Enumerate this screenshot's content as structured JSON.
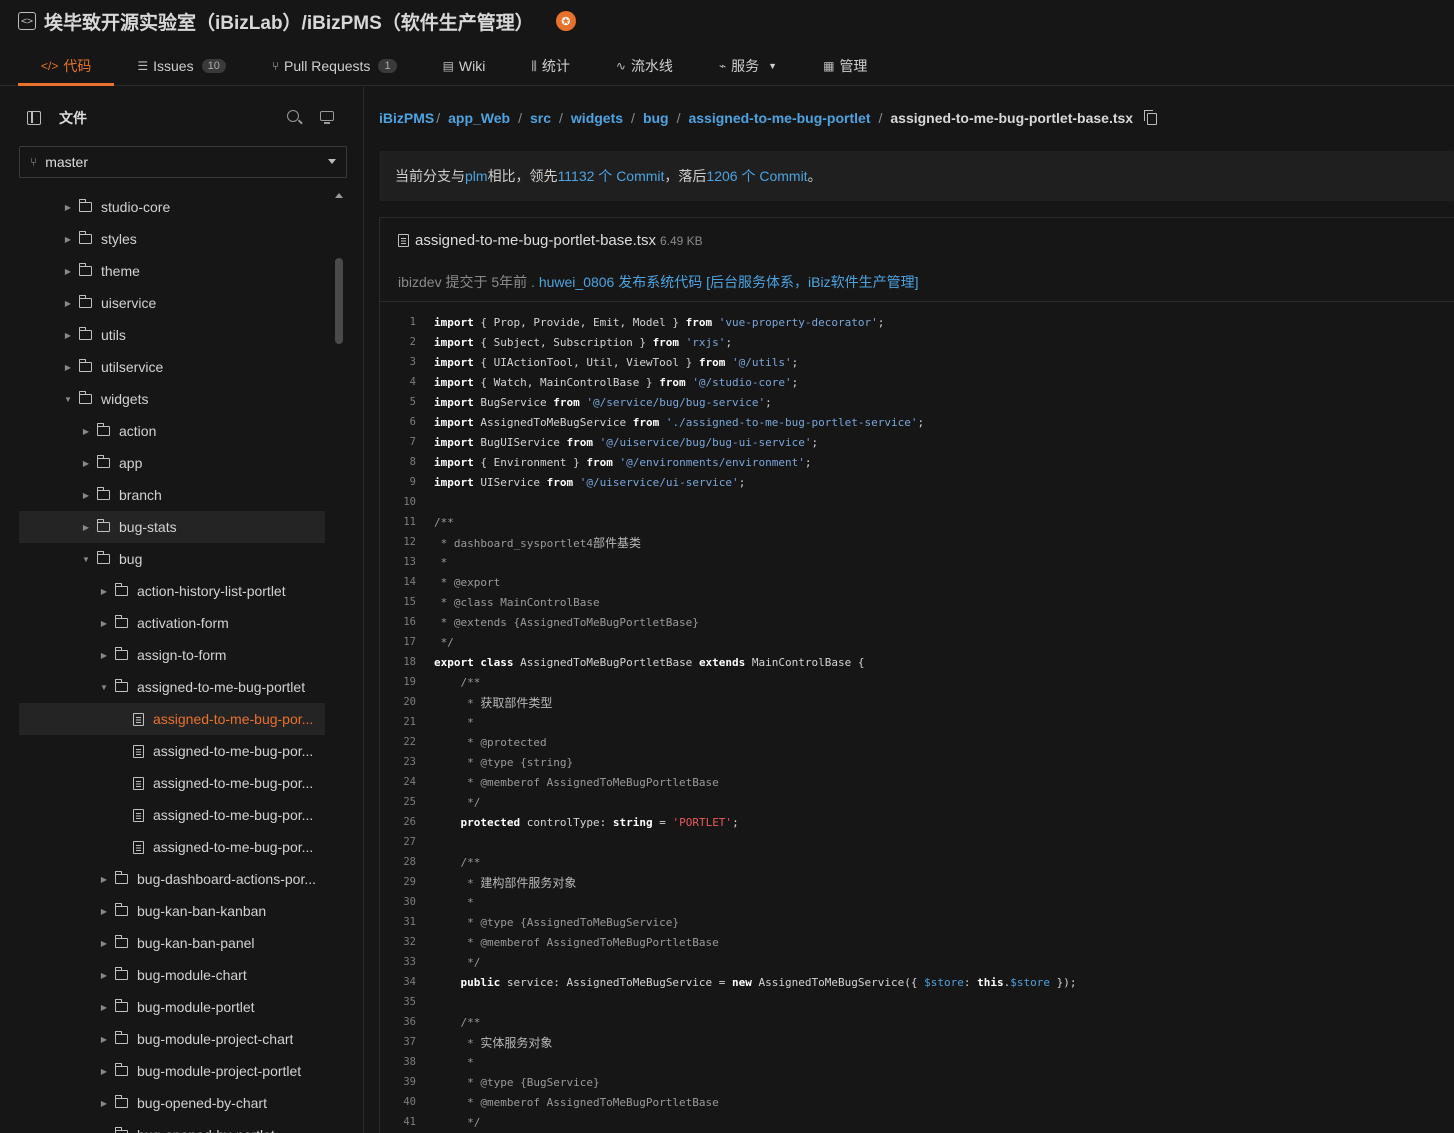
{
  "repo": {
    "title": "埃毕致开源实验室（iBizLab）/iBizPMS（软件生产管理）",
    "icon": "code-icon",
    "badge_icon": "gvp-badge-icon"
  },
  "tabs": [
    {
      "icon": "</>",
      "label": "代码",
      "active": true
    },
    {
      "icon": "☰",
      "label": "Issues",
      "count": "10"
    },
    {
      "icon": "⑂",
      "label": "Pull Requests",
      "count": "1"
    },
    {
      "icon": "▤",
      "label": "Wiki"
    },
    {
      "icon": "⫼",
      "label": "统计"
    },
    {
      "icon": "∿",
      "label": "流水线"
    },
    {
      "icon": "⌁",
      "label": "服务",
      "caret": true
    },
    {
      "icon": "▦",
      "label": "管理"
    }
  ],
  "sidebar": {
    "files_label": "文件",
    "branch": "master"
  },
  "tree": [
    {
      "name": "studio-core",
      "indent": 0,
      "type": "folder",
      "state": "collapsed"
    },
    {
      "name": "styles",
      "indent": 0,
      "type": "folder",
      "state": "collapsed"
    },
    {
      "name": "theme",
      "indent": 0,
      "type": "folder",
      "state": "collapsed"
    },
    {
      "name": "uiservice",
      "indent": 0,
      "type": "folder",
      "state": "collapsed"
    },
    {
      "name": "utils",
      "indent": 0,
      "type": "folder",
      "state": "collapsed"
    },
    {
      "name": "utilservice",
      "indent": 0,
      "type": "folder",
      "state": "collapsed"
    },
    {
      "name": "widgets",
      "indent": 0,
      "type": "folder",
      "state": "expanded"
    },
    {
      "name": "action",
      "indent": 1,
      "type": "folder",
      "state": "collapsed"
    },
    {
      "name": "app",
      "indent": 1,
      "type": "folder",
      "state": "collapsed"
    },
    {
      "name": "branch",
      "indent": 1,
      "type": "folder",
      "state": "collapsed"
    },
    {
      "name": "bug-stats",
      "indent": 1,
      "type": "folder",
      "state": "collapsed",
      "hover": true
    },
    {
      "name": "bug",
      "indent": 1,
      "type": "folder",
      "state": "expanded"
    },
    {
      "name": "action-history-list-portlet",
      "indent": 2,
      "type": "folder",
      "state": "collapsed"
    },
    {
      "name": "activation-form",
      "indent": 2,
      "type": "folder",
      "state": "collapsed"
    },
    {
      "name": "assign-to-form",
      "indent": 2,
      "type": "folder",
      "state": "collapsed"
    },
    {
      "name": "assigned-to-me-bug-portlet",
      "indent": 2,
      "type": "folder",
      "state": "expanded"
    },
    {
      "name": "assigned-to-me-bug-por...",
      "indent": 3,
      "type": "file",
      "active": true
    },
    {
      "name": "assigned-to-me-bug-por...",
      "indent": 3,
      "type": "file"
    },
    {
      "name": "assigned-to-me-bug-por...",
      "indent": 3,
      "type": "file"
    },
    {
      "name": "assigned-to-me-bug-por...",
      "indent": 3,
      "type": "file"
    },
    {
      "name": "assigned-to-me-bug-por...",
      "indent": 3,
      "type": "file"
    },
    {
      "name": "bug-dashboard-actions-por...",
      "indent": 2,
      "type": "folder",
      "state": "collapsed"
    },
    {
      "name": "bug-kan-ban-kanban",
      "indent": 2,
      "type": "folder",
      "state": "collapsed"
    },
    {
      "name": "bug-kan-ban-panel",
      "indent": 2,
      "type": "folder",
      "state": "collapsed"
    },
    {
      "name": "bug-module-chart",
      "indent": 2,
      "type": "folder",
      "state": "collapsed"
    },
    {
      "name": "bug-module-portlet",
      "indent": 2,
      "type": "folder",
      "state": "collapsed"
    },
    {
      "name": "bug-module-project-chart",
      "indent": 2,
      "type": "folder",
      "state": "collapsed"
    },
    {
      "name": "bug-module-project-portlet",
      "indent": 2,
      "type": "folder",
      "state": "collapsed"
    },
    {
      "name": "bug-opened-by-chart",
      "indent": 2,
      "type": "folder",
      "state": "collapsed"
    },
    {
      "name": "bug-opened-by-portlet",
      "indent": 2,
      "type": "folder",
      "state": "collapsed"
    }
  ],
  "breadcrumb": {
    "items": [
      "iBizPMS",
      "app_Web",
      "src",
      "widgets",
      "bug",
      "assigned-to-me-bug-portlet"
    ],
    "current": "assigned-to-me-bug-portlet-base.tsx"
  },
  "compare": {
    "prefix": "当前分支与 ",
    "branch": "plm",
    "mid1": " 相比，领先 ",
    "ahead": "11132 个 Commit",
    "mid2": "，落后 ",
    "behind": "1206 个 Commit",
    "suffix": "。"
  },
  "file": {
    "name": "assigned-to-me-bug-portlet-base.tsx",
    "size": "6.49 KB",
    "author": "ibizdev",
    "committed": " 提交于 5年前 . ",
    "commit_msg": "huwei_0806 发布系统代码 [后台服务体系，iBiz软件生产管理]"
  },
  "code": [
    "import { Prop, Provide, Emit, Model } from 'vue-property-decorator';",
    "import { Subject, Subscription } from 'rxjs';",
    "import { UIActionTool, Util, ViewTool } from '@/utils';",
    "import { Watch, MainControlBase } from '@/studio-core';",
    "import BugService from '@/service/bug/bug-service';",
    "import AssignedToMeBugService from './assigned-to-me-bug-portlet-service';",
    "import BugUIService from '@/uiservice/bug/bug-ui-service';",
    "import { Environment } from '@/environments/environment';",
    "import UIService from '@/uiservice/ui-service';",
    "",
    "/**",
    " * dashboard_sysportlet4部件基类",
    " *",
    " * @export",
    " * @class MainControlBase",
    " * @extends {AssignedToMeBugPortletBase}",
    " */",
    "export class AssignedToMeBugPortletBase extends MainControlBase {",
    "    /**",
    "     * 获取部件类型",
    "     *",
    "     * @protected",
    "     * @type {string}",
    "     * @memberof AssignedToMeBugPortletBase",
    "     */",
    "    protected controlType: string = 'PORTLET';",
    "",
    "    /**",
    "     * 建构部件服务对象",
    "     *",
    "     * @type {AssignedToMeBugService}",
    "     * @memberof AssignedToMeBugPortletBase",
    "     */",
    "    public service: AssignedToMeBugService = new AssignedToMeBugService({ $store: this.$store });",
    "",
    "    /**",
    "     * 实体服务对象",
    "     *",
    "     * @type {BugService}",
    "     * @memberof AssignedToMeBugPortletBase",
    "     */"
  ],
  "colors": {
    "accent": "#e8712b",
    "link": "#4da3e0",
    "background": "#161616"
  }
}
